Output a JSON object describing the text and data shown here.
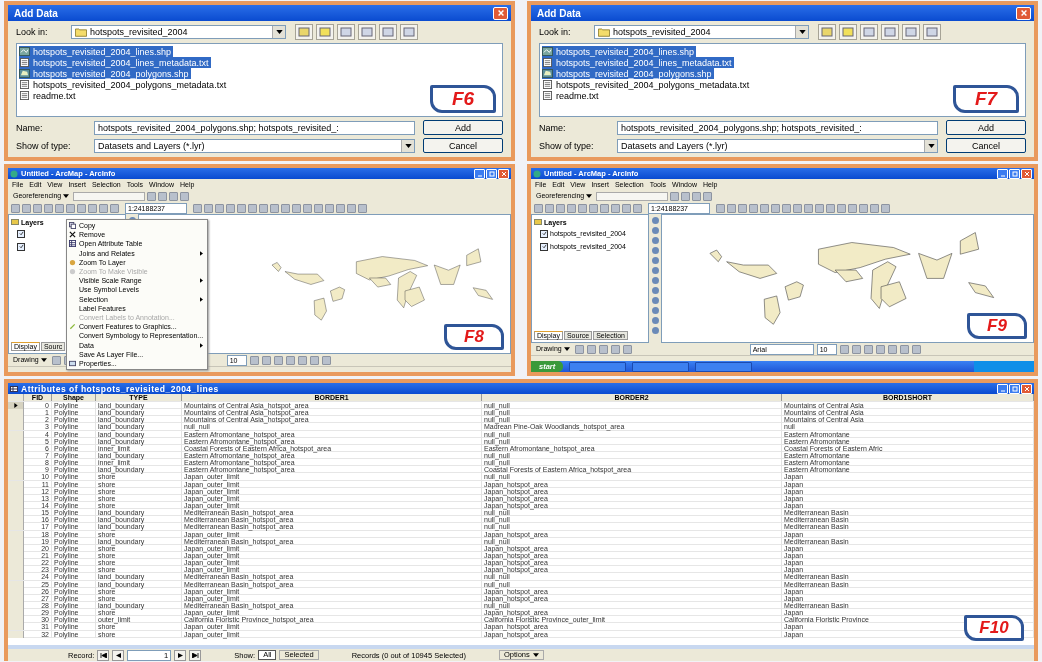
{
  "dialogs": [
    {
      "title": "Add Data",
      "look_in_label": "Look in:",
      "look_in": "hotspots_revisited_2004",
      "files": [
        {
          "name": "hotspots_revisited_2004_lines.shp",
          "kind": "lines",
          "selected": true
        },
        {
          "name": "hotspots_revisited_2004_lines_metadata.txt",
          "kind": "text",
          "selected": true
        },
        {
          "name": "hotspots_revisited_2004_polygons.shp",
          "kind": "polygons",
          "selected": true
        },
        {
          "name": "hotspots_revisited_2004_polygons_metadata.txt",
          "kind": "text",
          "selected": false
        },
        {
          "name": "readme.txt",
          "kind": "text",
          "selected": false
        }
      ],
      "name_label": "Name:",
      "name_value": "hotspots_revisited_2004_polygons.shp; hotspots_revisited_:",
      "type_label": "Show of type:",
      "type_value": "Datasets and Layers (*.lyr)",
      "buttons": [
        "Add",
        "Cancel"
      ],
      "figure_label": "F6"
    },
    {
      "title": "Add Data",
      "look_in_label": "Look in:",
      "look_in": "hotspots_revisited_2004",
      "files": [
        {
          "name": "hotspots_revisited_2004_lines.shp",
          "kind": "lines",
          "selected": true
        },
        {
          "name": "hotspots_revisited_2004_lines_metadata.txt",
          "kind": "text",
          "selected": true
        },
        {
          "name": "hotspots_revisited_2004_polygons.shp",
          "kind": "polygons",
          "selected": true
        },
        {
          "name": "hotspots_revisited_2004_polygons_metadata.txt",
          "kind": "text",
          "selected": false
        },
        {
          "name": "readme.txt",
          "kind": "text",
          "selected": false
        }
      ],
      "name_label": "Name:",
      "name_value": "hotspots_revisited_2004_polygons.shp; hotspots_revisited_:",
      "type_label": "Show of type:",
      "type_value": "Datasets and Layers (*.lyr)",
      "buttons": [
        "Add",
        "Cancel"
      ],
      "figure_label": "F7"
    }
  ],
  "arcmap_windows": [
    {
      "title": "Untitled - ArcMap - ArcInfo",
      "menu": [
        "File",
        "Edit",
        "View",
        "Insert",
        "Selection",
        "Tools",
        "Window",
        "Help"
      ],
      "georeferencing": "Georeferencing",
      "scale": "1:24188237",
      "toc_root": "Layers",
      "layers": [
        {
          "checked": true
        },
        {
          "checked": true
        }
      ],
      "tabs": [
        {
          "label": "Display",
          "selected": true
        },
        {
          "label": "Sourc",
          "selected": false
        }
      ],
      "drawing_label": "Drawing",
      "font_size": "10",
      "context_menu": [
        {
          "label": "Copy",
          "kind": "copy",
          "disabled": false,
          "submenu": false
        },
        {
          "label": "Remove",
          "kind": "remove",
          "disabled": false,
          "submenu": false
        },
        {
          "label": "Open Attribute Table",
          "kind": "table",
          "disabled": false,
          "submenu": false
        },
        {
          "label": "Joins and Relates",
          "kind": "plain",
          "disabled": false,
          "submenu": true
        },
        {
          "label": "Zoom To Layer",
          "kind": "zoom",
          "disabled": false,
          "submenu": false
        },
        {
          "label": "Zoom To Make Visible",
          "kind": "zoom",
          "disabled": true,
          "submenu": false
        },
        {
          "label": "Visible Scale Range",
          "kind": "plain",
          "disabled": false,
          "submenu": true
        },
        {
          "label": "Use Symbol Levels",
          "kind": "plain",
          "disabled": false,
          "submenu": false
        },
        {
          "label": "Selection",
          "kind": "plain",
          "disabled": false,
          "submenu": true
        },
        {
          "label": "Label Features",
          "kind": "plain",
          "disabled": false,
          "submenu": false
        },
        {
          "label": "Convert Labels to Annotation...",
          "kind": "plain",
          "disabled": true,
          "submenu": false
        },
        {
          "label": "Convert Features to Graphics...",
          "kind": "convert",
          "disabled": false,
          "submenu": false
        },
        {
          "label": "Convert Symbology to Representation...",
          "kind": "plain",
          "disabled": false,
          "submenu": false
        },
        {
          "label": "Data",
          "kind": "plain",
          "disabled": false,
          "submenu": true
        },
        {
          "label": "Save As Layer File...",
          "kind": "plain",
          "disabled": false,
          "submenu": false
        },
        {
          "label": "Properties...",
          "kind": "properties",
          "disabled": false,
          "submenu": false
        }
      ],
      "figure_label": "F8"
    },
    {
      "title": "Untitled - ArcMap - ArcInfo",
      "menu": [
        "File",
        "Edit",
        "View",
        "Insert",
        "Selection",
        "Tools",
        "Window",
        "Help"
      ],
      "georeferencing": "Georeferencing",
      "scale": "1:24188237",
      "toc_root": "Layers",
      "layers": [
        {
          "label": "hotspots_revisited_2004",
          "checked": true
        },
        {
          "label": "hotspots_revisited_2004",
          "checked": true
        }
      ],
      "tabs": [
        {
          "label": "Display",
          "selected": true
        },
        {
          "label": "Source",
          "selected": false
        },
        {
          "label": "Selection",
          "selected": false
        }
      ],
      "drawing_label": "Drawing",
      "font": "Arial",
      "font_size": "10",
      "taskbar": {
        "start": "start"
      },
      "figure_label": "F9"
    }
  ],
  "table": {
    "title": "Attributes of hotspots_revisited_2004_lines",
    "columns": [
      "FID",
      "Shape",
      "TYPE",
      "BORDER1",
      "BORDER2",
      "BORD1SHORT"
    ],
    "rows": [
      {
        "current": true,
        "cells": [
          "0",
          "Polyline",
          "land_boundary",
          "Mountains of Central Asia_hotspot_area",
          "null_null",
          "Mountains of Central Asia"
        ]
      },
      {
        "current": false,
        "cells": [
          "1",
          "Polyline",
          "land_boundary",
          "Mountains of Central Asia_hotspot_area",
          "null_null",
          "Mountains of Central Asia"
        ]
      },
      {
        "current": false,
        "cells": [
          "2",
          "Polyline",
          "land_boundary",
          "Mountains of Central Asia_hotspot_area",
          "null_null",
          "Mountains of Central Asia"
        ]
      },
      {
        "current": false,
        "cells": [
          "3",
          "Polyline",
          "land_boundary",
          "null_null",
          "Madrean Pine-Oak Woodlands_hotspot_area",
          "null"
        ]
      },
      {
        "current": false,
        "cells": [
          "4",
          "Polyline",
          "land_boundary",
          "Eastern Afromontane_hotspot_area",
          "null_null",
          "Eastern Afromontane"
        ]
      },
      {
        "current": false,
        "cells": [
          "5",
          "Polyline",
          "land_boundary",
          "Eastern Afromontane_hotspot_area",
          "null_null",
          "Eastern Afromontane"
        ]
      },
      {
        "current": false,
        "cells": [
          "6",
          "Polyline",
          "inner_limit",
          "Coastal Forests of Eastern Africa_hotspot_area",
          "Eastern Afromontane_hotspot_area",
          "Coastal Forests of Eastern Afric"
        ]
      },
      {
        "current": false,
        "cells": [
          "7",
          "Polyline",
          "land_boundary",
          "Eastern Afromontane_hotspot_area",
          "null_null",
          "Eastern Afromontane"
        ]
      },
      {
        "current": false,
        "cells": [
          "8",
          "Polyline",
          "inner_limit",
          "Eastern Afromontane_hotspot_area",
          "null_null",
          "Eastern Afromontane"
        ]
      },
      {
        "current": false,
        "cells": [
          "9",
          "Polyline",
          "land_boundary",
          "Eastern Afromontane_hotspot_area",
          "Coastal Forests of Eastern Africa_hotspot_area",
          "Eastern Afromontane"
        ]
      },
      {
        "current": false,
        "cells": [
          "10",
          "Polyline",
          "shore",
          "Japan_outer_limit",
          "null_null",
          "Japan"
        ]
      },
      {
        "current": false,
        "cells": [
          "11",
          "Polyline",
          "shore",
          "Japan_outer_limit",
          "Japan_hotspot_area",
          "Japan"
        ]
      },
      {
        "current": false,
        "cells": [
          "12",
          "Polyline",
          "shore",
          "Japan_outer_limit",
          "Japan_hotspot_area",
          "Japan"
        ]
      },
      {
        "current": false,
        "cells": [
          "13",
          "Polyline",
          "shore",
          "Japan_outer_limit",
          "Japan_hotspot_area",
          "Japan"
        ]
      },
      {
        "current": false,
        "cells": [
          "14",
          "Polyline",
          "shore",
          "Japan_outer_limit",
          "Japan_hotspot_area",
          "Japan"
        ]
      },
      {
        "current": false,
        "cells": [
          "15",
          "Polyline",
          "land_boundary",
          "Mediterranean Basin_hotspot_area",
          "null_null",
          "Mediterranean Basin"
        ]
      },
      {
        "current": false,
        "cells": [
          "16",
          "Polyline",
          "land_boundary",
          "Mediterranean Basin_hotspot_area",
          "null_null",
          "Mediterranean Basin"
        ]
      },
      {
        "current": false,
        "cells": [
          "17",
          "Polyline",
          "land_boundary",
          "Mediterranean Basin_hotspot_area",
          "null_null",
          "Mediterranean Basin"
        ]
      },
      {
        "current": false,
        "cells": [
          "18",
          "Polyline",
          "shore",
          "Japan_outer_limit",
          "Japan_hotspot_area",
          "Japan"
        ]
      },
      {
        "current": false,
        "cells": [
          "19",
          "Polyline",
          "land_boundary",
          "Mediterranean Basin_hotspot_area",
          "null_null",
          "Mediterranean Basin"
        ]
      },
      {
        "current": false,
        "cells": [
          "20",
          "Polyline",
          "shore",
          "Japan_outer_limit",
          "Japan_hotspot_area",
          "Japan"
        ]
      },
      {
        "current": false,
        "cells": [
          "21",
          "Polyline",
          "shore",
          "Japan_outer_limit",
          "Japan_hotspot_area",
          "Japan"
        ]
      },
      {
        "current": false,
        "cells": [
          "22",
          "Polyline",
          "shore",
          "Japan_outer_limit",
          "Japan_hotspot_area",
          "Japan"
        ]
      },
      {
        "current": false,
        "cells": [
          "23",
          "Polyline",
          "shore",
          "Japan_outer_limit",
          "Japan_hotspot_area",
          "Japan"
        ]
      },
      {
        "current": false,
        "cells": [
          "24",
          "Polyline",
          "land_boundary",
          "Mediterranean Basin_hotspot_area",
          "null_null",
          "Mediterranean Basin"
        ]
      },
      {
        "current": false,
        "cells": [
          "25",
          "Polyline",
          "land_boundary",
          "Mediterranean Basin_hotspot_area",
          "null_null",
          "Mediterranean Basin"
        ]
      },
      {
        "current": false,
        "cells": [
          "26",
          "Polyline",
          "shore",
          "Japan_outer_limit",
          "Japan_hotspot_area",
          "Japan"
        ]
      },
      {
        "current": false,
        "cells": [
          "27",
          "Polyline",
          "shore",
          "Japan_outer_limit",
          "Japan_hotspot_area",
          "Japan"
        ]
      },
      {
        "current": false,
        "cells": [
          "28",
          "Polyline",
          "land_boundary",
          "Mediterranean Basin_hotspot_area",
          "null_null",
          "Mediterranean Basin"
        ]
      },
      {
        "current": false,
        "cells": [
          "29",
          "Polyline",
          "shore",
          "Japan_outer_limit",
          "Japan_hotspot_area",
          "Japan"
        ]
      },
      {
        "current": false,
        "cells": [
          "30",
          "Polyline",
          "outer_limit",
          "California Floristic Province_hotspot_area",
          "California Floristic Province_outer_limit",
          "California Floristic Province"
        ]
      },
      {
        "current": false,
        "cells": [
          "31",
          "Polyline",
          "shore",
          "Japan_outer_limit",
          "Japan_hotspot_area",
          "Japan"
        ]
      },
      {
        "current": false,
        "cells": [
          "32",
          "Polyline",
          "shore",
          "Japan_outer_limit",
          "Japan_hotspot_area",
          "Japan"
        ]
      }
    ],
    "record_label": "Record:",
    "record_value": "1",
    "show_label": "Show:",
    "show_buttons": [
      {
        "label": "All",
        "selected": true
      },
      {
        "label": "Selected",
        "selected": false
      }
    ],
    "records_status": "Records (0 out of 10945 Selected)",
    "options": "Options",
    "figure_label": "F10"
  }
}
